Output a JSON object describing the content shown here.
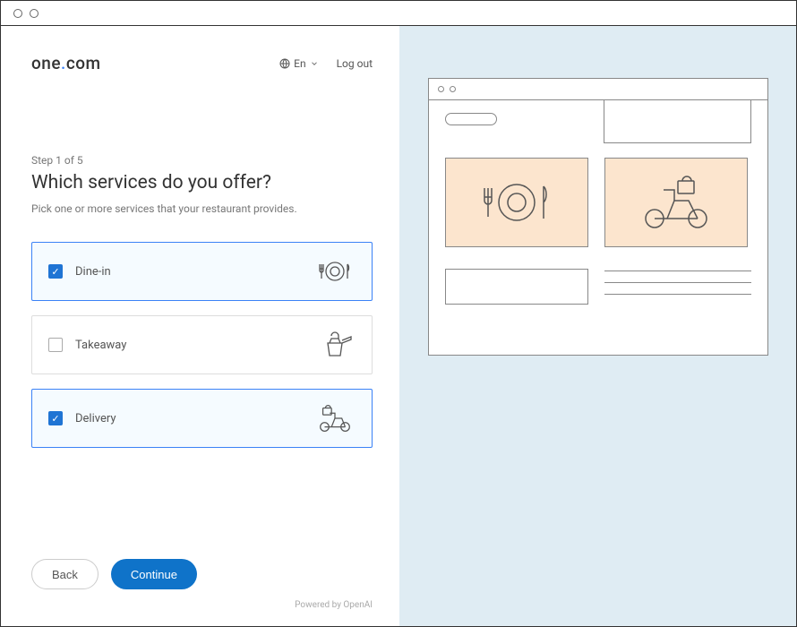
{
  "brand": {
    "prefix": "one",
    "dot": ".",
    "suffix": "com"
  },
  "header": {
    "language": "En",
    "logout": "Log out"
  },
  "wizard": {
    "step_label": "Step 1 of 5",
    "heading": "Which services do you offer?",
    "subheading": "Pick one or more services that your restaurant provides."
  },
  "options": [
    {
      "key": "dine-in",
      "label": "Dine-in",
      "selected": true
    },
    {
      "key": "takeaway",
      "label": "Takeaway",
      "selected": false
    },
    {
      "key": "delivery",
      "label": "Delivery",
      "selected": true
    }
  ],
  "buttons": {
    "back": "Back",
    "continue": "Continue"
  },
  "powered": "Powered by OpenAI"
}
